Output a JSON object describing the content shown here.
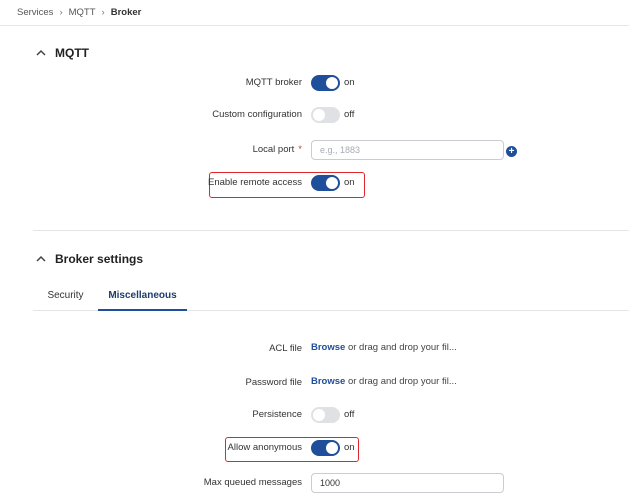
{
  "breadcrumb": {
    "items": [
      "Services",
      "MQTT"
    ],
    "current": "Broker",
    "separator": "›"
  },
  "mqtt_section": {
    "title": "MQTT",
    "mqtt_broker": {
      "label": "MQTT broker",
      "state": "on"
    },
    "custom_configuration": {
      "label": "Custom configuration",
      "state": "off"
    },
    "local_port": {
      "label": "Local port",
      "required_mark": "*",
      "placeholder": "e.g., 1883",
      "value": ""
    },
    "enable_remote_access": {
      "label": "Enable remote access",
      "state": "on"
    }
  },
  "broker_section": {
    "title": "Broker settings",
    "tabs": [
      {
        "label": "Security",
        "active": false
      },
      {
        "label": "Miscellaneous",
        "active": true
      }
    ],
    "acl_file": {
      "label": "ACL file",
      "browse": "Browse",
      "hint": "or drag and drop your fil..."
    },
    "password_file": {
      "label": "Password file",
      "browse": "Browse",
      "hint": "or drag and drop your fil..."
    },
    "persistence": {
      "label": "Persistence",
      "state": "off"
    },
    "allow_anonymous": {
      "label": "Allow anonymous",
      "state": "on"
    },
    "max_queued_messages": {
      "label": "Max queued messages",
      "value": "1000"
    }
  },
  "colors": {
    "accent": "#1f4e9a",
    "highlight": "#e0262a",
    "toggle_off": "#dfe1e4"
  },
  "icons": {
    "section_toggle": "chevron-up-icon",
    "add": "plus-circle-icon"
  }
}
